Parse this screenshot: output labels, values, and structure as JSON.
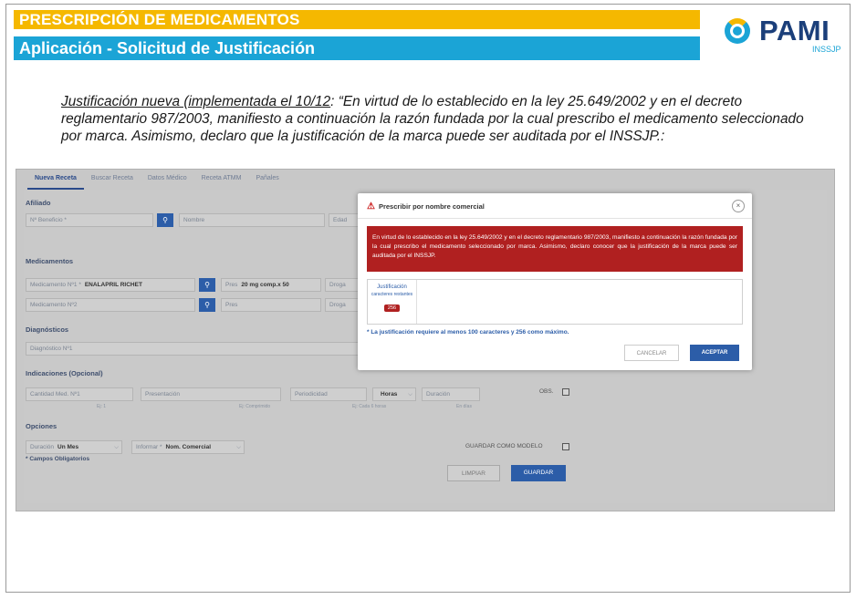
{
  "header": {
    "title": "PRESCRIPCIÓN DE MEDICAMENTOS",
    "subtitle": "Aplicación - Solicitud de Justificación",
    "logo_text": "PAMI",
    "logo_sub": "INSSJP"
  },
  "intro": {
    "underlined": "Justificación nueva (implementada el 10/12",
    "rest": ": “En virtud de lo establecido en la ley 25.649/2002 y en el decreto reglamentario 987/2003, manifiesto a continuación la razón fundada por la cual prescribo el medicamento seleccionado por marca. Asimismo, declaro que la justificación de la marca puede ser auditada por el INSSJP.:"
  },
  "app": {
    "tabs": [
      "Nueva Receta",
      "Buscar Receta",
      "Datos Médico",
      "Receta ATMM",
      "Pañales"
    ],
    "afiliado": {
      "section": "Afiliado",
      "beneficio_label": "Nº Beneficio *",
      "nombre_label": "Nombre",
      "edad_label": "Edad"
    },
    "medicamentos": {
      "section": "Medicamentos",
      "med1_label": "Medicamento Nº1 *",
      "med1_value": "ENALAPRIL RICHET",
      "pres1_label": "Pres",
      "pres1_value": "20 mg comp.x 50",
      "droga1_label": "Droga",
      "med2_label": "Medicamento Nº2",
      "pres2_label": "Pres",
      "droga2_label": "Droga"
    },
    "diagnosticos": {
      "section": "Diagnósticos",
      "diag1_label": "Diagnóstico Nº1"
    },
    "indicaciones": {
      "section": "Indicaciones (Opcional)",
      "cantidad_label": "Cantidad Med. Nº1",
      "cantidad_hint": "Ej: 1",
      "presentacion_label": "Presentación",
      "presentacion_hint": "Ej: Comprimido",
      "periodicidad_label": "Periodicidad",
      "periodicidad_hint": "Ej: Cada 6 horas",
      "horas_value": "Horas",
      "duracion_label": "Duración",
      "duracion_hint": "En días",
      "obs_label": "OBS."
    },
    "opciones": {
      "section": "Opciones",
      "duracion_label": "Duración",
      "duracion_value": "Un Mes",
      "informar_label": "Informar *",
      "informar_value": "Nom. Comercial",
      "guardar_modelo_label": "GUARDAR COMO MODELO",
      "required_note": "* Campos Obligatorios",
      "limpiar": "LIMPIAR",
      "guardar": "GUARDAR"
    }
  },
  "modal": {
    "title": "Prescribir por nombre comercial",
    "close": "×",
    "alert": "En virtud de lo establecido en la ley 25.649/2002 y en el decreto reglamentario 987/2003, manifiesto a continuación la razón fundada por la cual prescribo el medicamento seleccionado por marca. Asimismo, declaro conocer que la justificación de la marca puede ser auditada por el INSSJP.",
    "textarea_label": "Justificación",
    "remaining_label": "caracteres restantes",
    "remaining_count": "256",
    "note": "* La justificación requiere al menos 100 caracteres y 256 como máximo.",
    "cancel": "CANCELAR",
    "accept": "ACEPTAR"
  }
}
